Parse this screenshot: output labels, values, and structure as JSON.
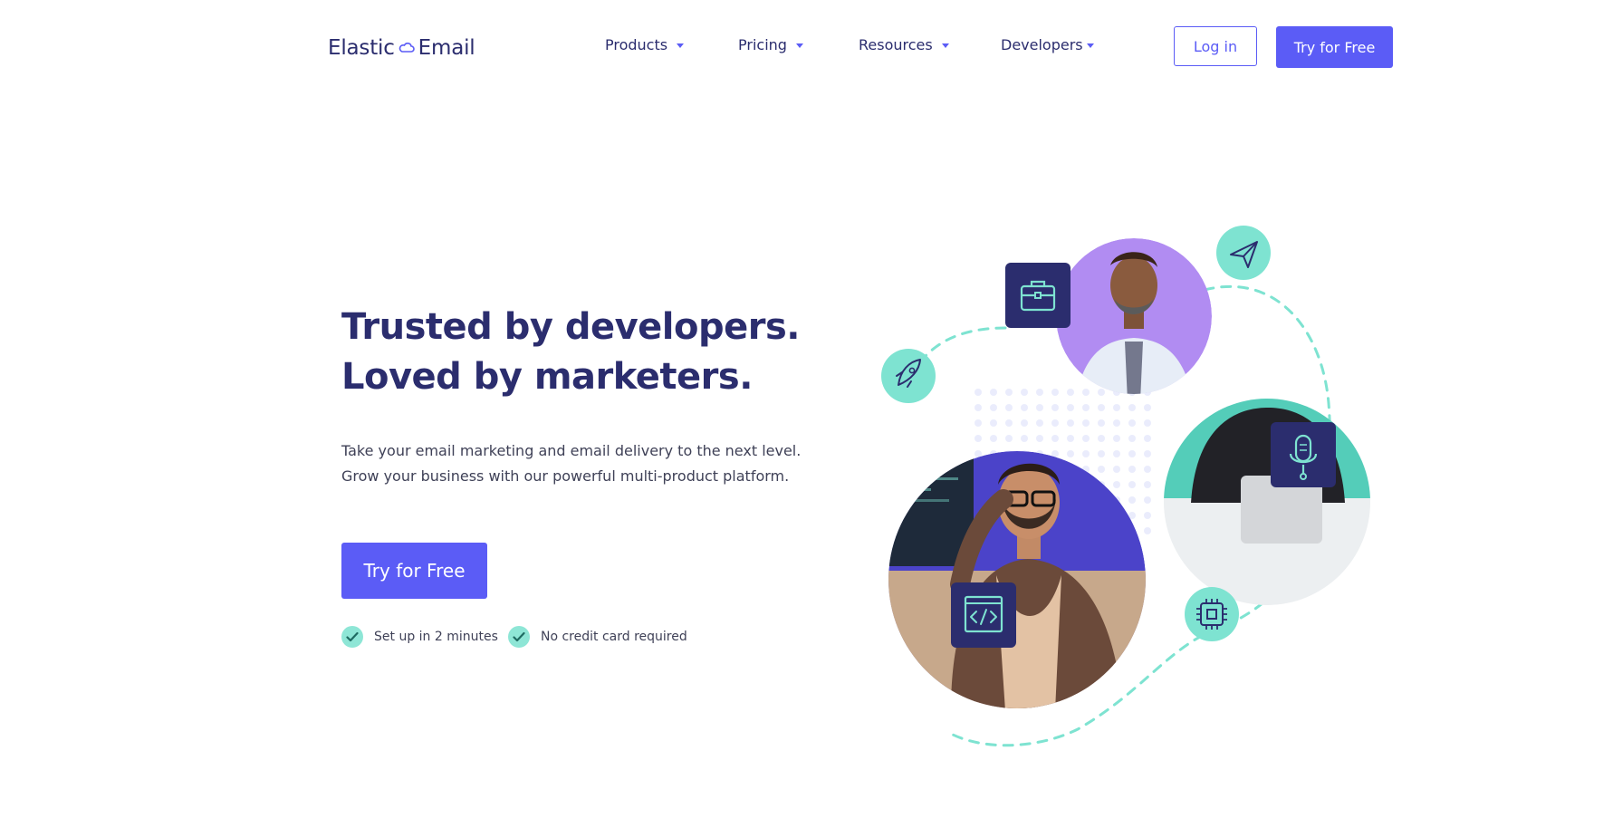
{
  "nav": {
    "logo": {
      "left": "Elastic",
      "right": "Email"
    },
    "items": [
      {
        "label": "Products"
      },
      {
        "label": "Pricing"
      },
      {
        "label": "Resources"
      },
      {
        "label": "Developers"
      }
    ],
    "login_label": "Log in",
    "try_label": "Try for Free"
  },
  "hero": {
    "headline_line1": "Trusted by developers.",
    "headline_line2": "Loved by marketers.",
    "sub_line1": "Take your email marketing and email delivery to the next level.",
    "sub_line2": "Grow your business with our powerful multi-product platform.",
    "cta_label": "Try for Free",
    "checks": [
      {
        "label": "Set up in 2 minutes"
      },
      {
        "label": "No credit card required"
      }
    ]
  },
  "illustration": {
    "icons": [
      "briefcase-icon",
      "paper-plane-icon",
      "rocket-icon",
      "microphone-icon",
      "code-window-icon",
      "chip-icon"
    ],
    "colors": {
      "brand": "#5b5cf6",
      "navy": "#2b2d6e",
      "teal": "#7ee3d1",
      "purple": "#b18cf2",
      "indigo": "#4b43c9"
    }
  }
}
